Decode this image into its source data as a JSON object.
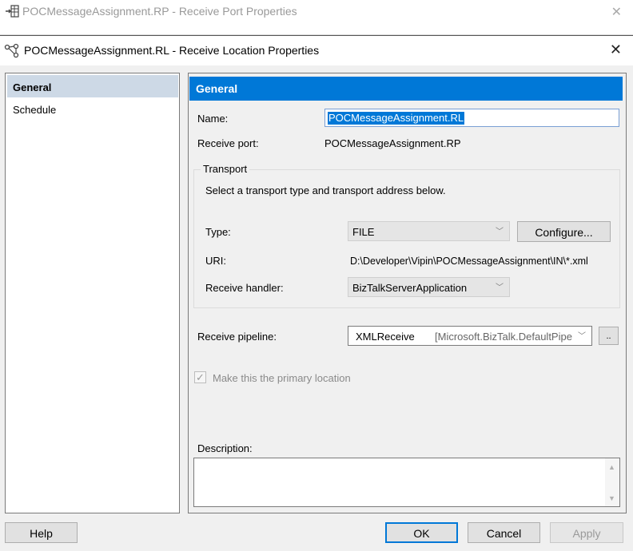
{
  "background_window": {
    "title": "POCMessageAssignment.RP - Receive Port Properties",
    "close_label": "✕"
  },
  "window": {
    "title": "POCMessageAssignment.RL - Receive Location Properties",
    "close_label": "✕"
  },
  "nav": {
    "items": [
      {
        "label": "General",
        "selected": true
      },
      {
        "label": "Schedule",
        "selected": false
      }
    ]
  },
  "general": {
    "header": "General",
    "name_label": "Name:",
    "name_value": "POCMessageAssignment.RL",
    "receive_port_label": "Receive port:",
    "receive_port_value": "POCMessageAssignment.RP",
    "transport": {
      "group_label": "Transport",
      "instructions": "Select a transport type and transport address below.",
      "type_label": "Type:",
      "type_value": "FILE",
      "configure_label": "Configure...",
      "uri_label": "URI:",
      "uri_value": "D:\\Developer\\Vipin\\POCMessageAssignment\\IN\\*.xml",
      "handler_label": "Receive handler:",
      "handler_value": "BizTalkServerApplication"
    },
    "pipeline_label": "Receive pipeline:",
    "pipeline_value": "XMLReceive",
    "pipeline_assembly": "[Microsoft.BizTalk.DefaultPipe",
    "pipeline_browse_label": "..",
    "primary_location_label": "Make this the primary location",
    "description_label": "Description:",
    "description_value": ""
  },
  "footer": {
    "help_label": "Help",
    "ok_label": "OK",
    "cancel_label": "Cancel",
    "apply_label": "Apply"
  },
  "colors": {
    "accent": "#0078d7",
    "nav_selected": "#cdd9e6",
    "window_bg": "#f0f0f0"
  },
  "icons": {
    "background_window": "receive-port-icon",
    "window": "receive-location-icon",
    "dropdown": "chevron-down-icon"
  }
}
